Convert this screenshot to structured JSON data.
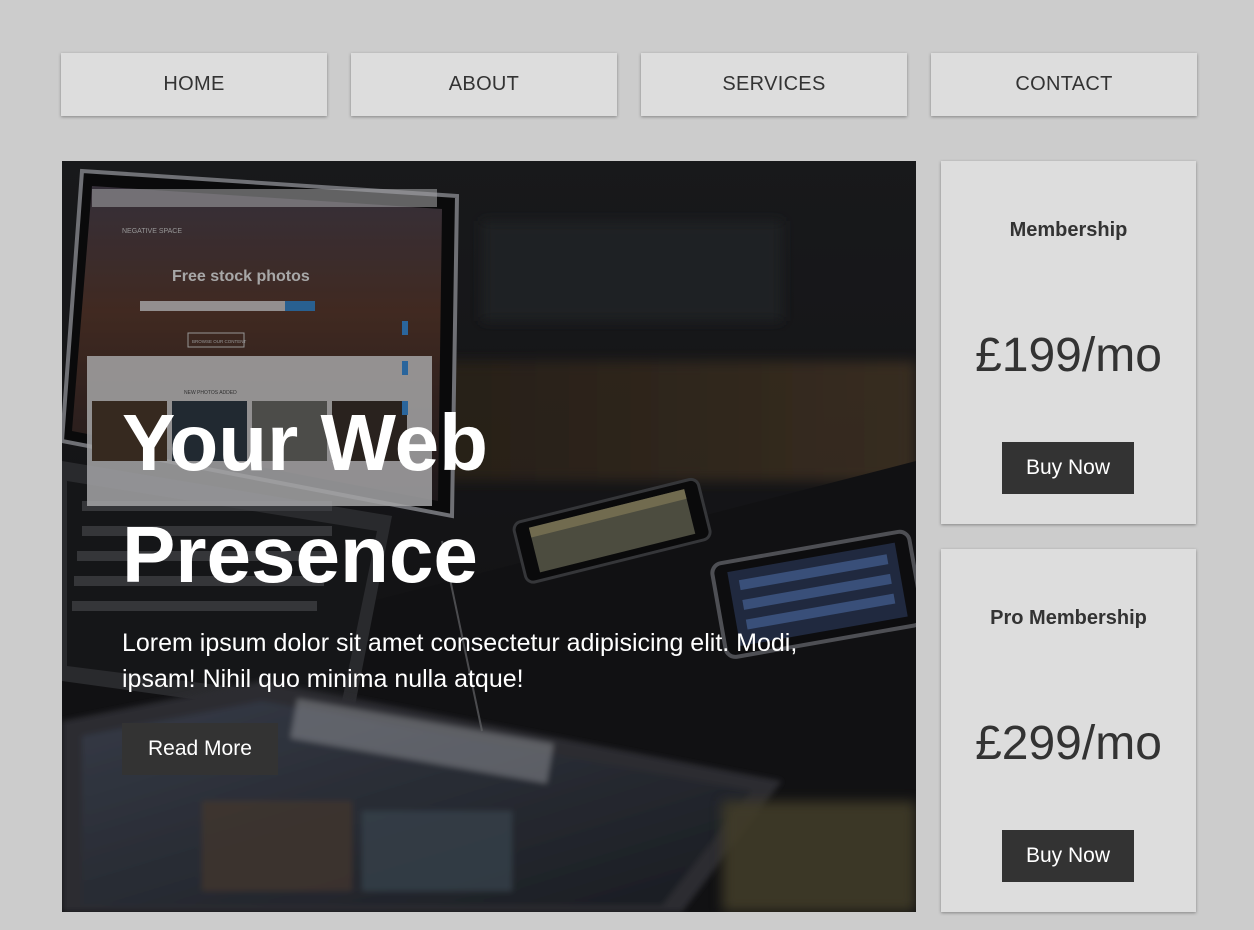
{
  "nav": {
    "items": [
      {
        "label": "HOME"
      },
      {
        "label": "ABOUT"
      },
      {
        "label": "SERVICES"
      },
      {
        "label": "CONTACT"
      }
    ]
  },
  "hero": {
    "title": "Your Web Presence",
    "text": "Lorem ipsum dolor sit amet consectetur adipisicing elit. Modi, ipsam! Nihil quo minima nulla atque!",
    "button_label": "Read More",
    "photo": {
      "laptop_screen_heading": "Free stock photos",
      "laptop_screen_logo": "NEGATIVE SPACE",
      "laptop_screen_section": "NEW PHOTOS ADDED",
      "laptop_screen_button": "BROWSE OUR CONTENT"
    }
  },
  "pricing": [
    {
      "title": "Membership",
      "price": "£199/mo",
      "button_label": "Buy Now"
    },
    {
      "title": "Pro Membership",
      "price": "£299/mo",
      "button_label": "Buy Now"
    }
  ],
  "colors": {
    "page_background": "#cccccc",
    "panel_background": "#dddddd",
    "button_dark": "#333333",
    "text_dark": "#333333",
    "text_light": "#ffffff"
  }
}
